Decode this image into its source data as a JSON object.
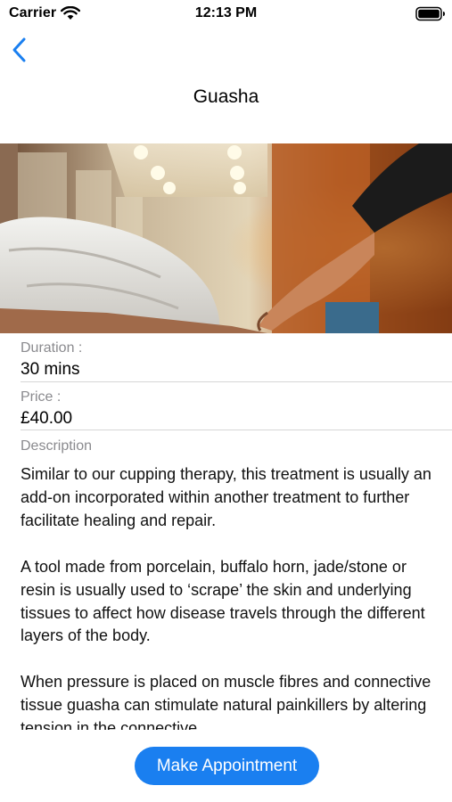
{
  "status_bar": {
    "carrier": "Carrier",
    "time": "12:13 PM"
  },
  "nav": {
    "back_icon": "chevron-left-icon",
    "title": "Guasha"
  },
  "hero_image": {
    "subject": "massage-treatment-photo"
  },
  "details": {
    "duration_label": "Duration :",
    "duration_value": "30 mins",
    "price_label": "Price :",
    "price_value": "£40.00",
    "description_label": "Description",
    "description_paragraphs": [
      "Similar to our cupping therapy, this treatment is usually an add-on incorporated within another treatment to further facilitate healing and repair.",
      "A tool made from porcelain, buffalo horn, jade/stone or resin is usually used to ‘scrape’ the skin and underlying tissues to affect how disease travels through the different layers of the body.",
      "When pressure is placed on muscle fibres and connective tissue guasha can stimulate natural painkillers by altering tension in the connective"
    ]
  },
  "actions": {
    "make_appointment": "Make Appointment"
  },
  "colors": {
    "accent": "#1a7ff0",
    "label_gray": "#8a8a8e",
    "divider": "#d6d6d6"
  }
}
